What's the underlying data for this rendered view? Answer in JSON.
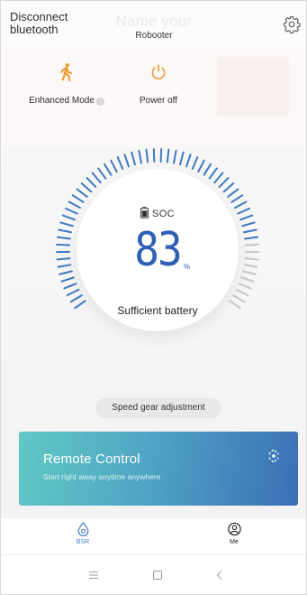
{
  "header": {
    "disconnect_label": "Disconnect bluetooth",
    "title_ghost": "Name your",
    "device_name": "Robooter",
    "settings_icon": "gear-icon"
  },
  "modes": [
    {
      "label": "Enhanced Mode",
      "icon": "walking-person-icon",
      "color": "#f1952a",
      "has_info": true
    },
    {
      "label": "Power off",
      "icon": "power-icon",
      "color": "#f1952a"
    }
  ],
  "gauge": {
    "label": "SOC",
    "value": "83",
    "unit": "%",
    "level": 0.83,
    "status": "Sufficient battery",
    "accent_color": "#3f78c5",
    "track_color": "#c7c7c7"
  },
  "speed_gear_label": "Speed gear adjustment",
  "remote": {
    "title": "Remote Control",
    "subtitle": "Start right away anytime anywhere",
    "icon": "remote-target-icon"
  },
  "tabs": [
    {
      "label": "BSR",
      "icon": "droplet-icon",
      "active": true
    },
    {
      "label": "Me",
      "icon": "user-circle-icon",
      "active": false
    }
  ],
  "system_nav": [
    "menu-icon",
    "home-icon",
    "back-icon"
  ]
}
